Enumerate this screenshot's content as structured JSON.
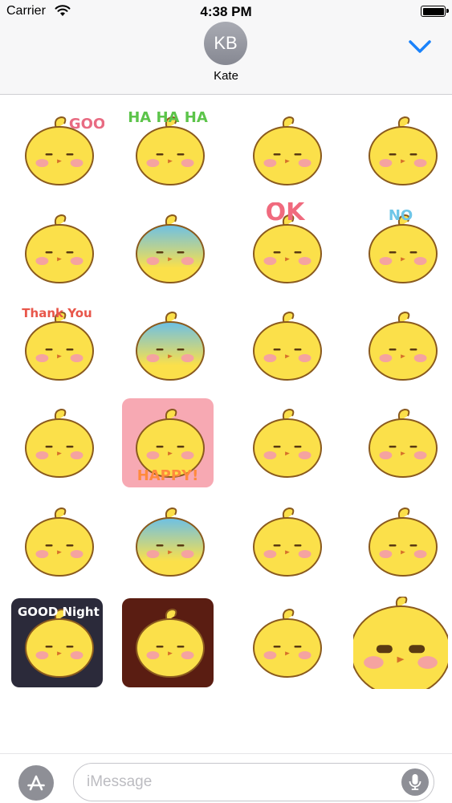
{
  "status_bar": {
    "carrier": "Carrier",
    "time": "4:38 PM",
    "wifi_icon": "wifi-icon",
    "battery_icon": "battery-icon"
  },
  "header": {
    "avatar_initials": "KB",
    "contact_name": "Kate",
    "collapse_icon": "chevron-down-icon"
  },
  "stickers": [
    {
      "label": "GOOD",
      "icon": "chick-thumbs-up-good-sticker"
    },
    {
      "label": "HA HA HA",
      "icon": "chick-laughing-sticker"
    },
    {
      "label": "",
      "icon": "chick-hearts-sticker"
    },
    {
      "label": "",
      "icon": "chick-angry-steam-sticker"
    },
    {
      "label": "",
      "icon": "chick-pleading-sticker"
    },
    {
      "label": "",
      "icon": "chick-gloomy-rain-sticker"
    },
    {
      "label": "OK",
      "icon": "chick-ok-sticker"
    },
    {
      "label": "NO",
      "icon": "chick-no-sticker"
    },
    {
      "label": "Thank You",
      "icon": "chick-thank-you-heart-sticker"
    },
    {
      "label": "",
      "icon": "chick-depressed-lying-sticker"
    },
    {
      "label": "",
      "icon": "chick-idea-bulb-sticker"
    },
    {
      "label": "",
      "icon": "chick-cheering-pompom-sticker"
    },
    {
      "label": "",
      "icon": "chick-confused-question-sticker"
    },
    {
      "label": "HAPPY!",
      "icon": "chick-happy-sticker"
    },
    {
      "label": "",
      "icon": "chick-thinking-sticker"
    },
    {
      "label": "",
      "icon": "chick-crying-sticker"
    },
    {
      "label": "",
      "icon": "chick-sparkle-sticker"
    },
    {
      "label": "",
      "icon": "chick-shocked-sticker"
    },
    {
      "label": "",
      "icon": "chick-smug-sticker"
    },
    {
      "label": "",
      "icon": "chick-sleeping-sticker"
    },
    {
      "label": "GOOD Night",
      "icon": "chick-good-night-sticker"
    },
    {
      "label": "",
      "icon": "chick-fire-rage-sticker"
    },
    {
      "label": "",
      "icon": "chick-dashing-sticker"
    },
    {
      "label": "",
      "icon": "chick-closeup-face-sticker"
    }
  ],
  "input_bar": {
    "apps_icon": "app-store-icon",
    "placeholder": "iMessage",
    "mic_icon": "microphone-icon"
  },
  "colors": {
    "chick_yellow": "#fbe04a",
    "chick_outline": "#8a5a1e",
    "cheek_pink": "#f5a3a0",
    "accent_blue": "#1a82fb",
    "avatar_gray": "#9c9ea6"
  }
}
